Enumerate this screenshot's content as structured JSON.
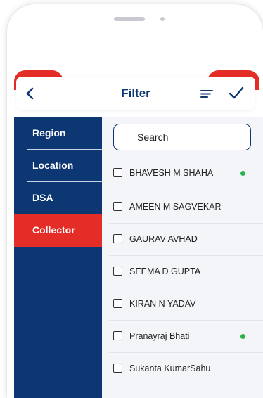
{
  "header": {
    "title": "Filter"
  },
  "colors": {
    "navy": "#0d3773",
    "accent_red": "#e52d27",
    "online_green": "#2bb24c"
  },
  "icons": {
    "back": "chevron-left-icon",
    "sort": "sort-lines-icon",
    "apply": "checkmark-icon"
  },
  "sidebar": {
    "items": [
      {
        "label": "Region",
        "active": false
      },
      {
        "label": "Location",
        "active": false
      },
      {
        "label": "DSA",
        "active": false
      },
      {
        "label": "Collector",
        "active": true
      }
    ]
  },
  "search": {
    "placeholder": "Search"
  },
  "collectors": [
    {
      "name": "BHAVESH M SHAHA",
      "checked": false,
      "online": true
    },
    {
      "name": "AMEEN M SAGVEKAR",
      "checked": false,
      "online": false
    },
    {
      "name": "GAURAV AVHAD",
      "checked": false,
      "online": false
    },
    {
      "name": "SEEMA D GUPTA",
      "checked": false,
      "online": false
    },
    {
      "name": "KIRAN N YADAV",
      "checked": false,
      "online": false
    },
    {
      "name": "Pranayraj Bhati",
      "checked": false,
      "online": true
    },
    {
      "name": "Sukanta KumarSahu",
      "checked": false,
      "online": false
    }
  ]
}
